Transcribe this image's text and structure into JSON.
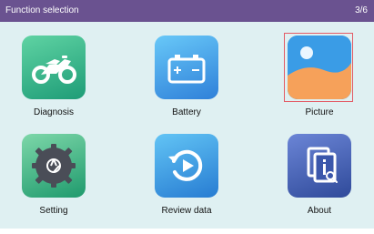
{
  "header": {
    "title": "Function selection",
    "page_indicator": "3/6"
  },
  "functions": [
    {
      "label": "Diagnosis",
      "icon": "motorcycle-icon",
      "selected": false
    },
    {
      "label": "Battery",
      "icon": "battery-icon",
      "selected": false
    },
    {
      "label": "Picture",
      "icon": "picture-icon",
      "selected": true
    },
    {
      "label": "Setting",
      "icon": "settings-icon",
      "selected": false
    },
    {
      "label": "Review data",
      "icon": "review-data-icon",
      "selected": false
    },
    {
      "label": "About",
      "icon": "about-icon",
      "selected": false
    }
  ],
  "colors": {
    "header_bg": "#6a5290",
    "screen_bg": "#dff0f2",
    "selection_border": "#e35b66"
  }
}
